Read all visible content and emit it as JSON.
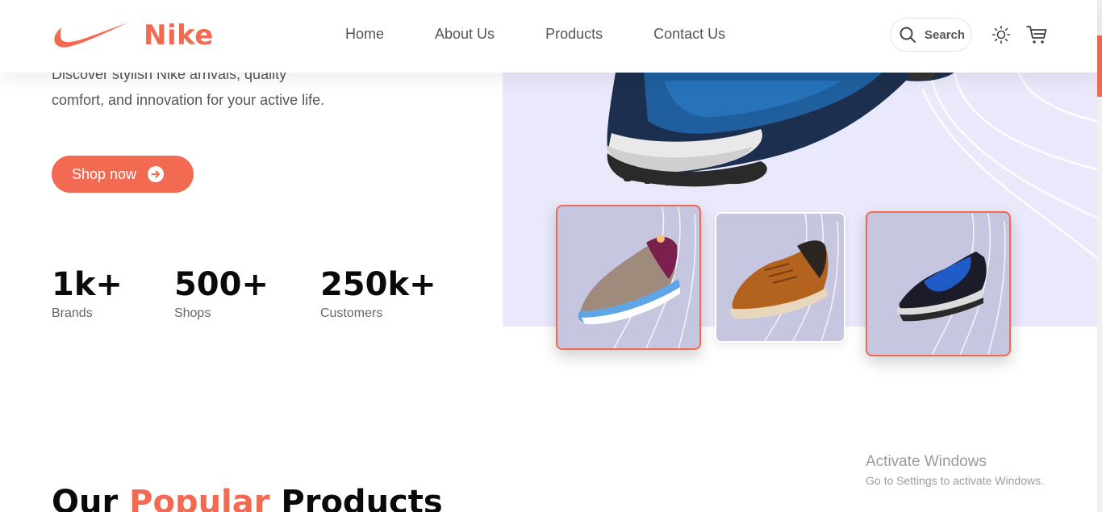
{
  "brand": {
    "name": "Nike",
    "accent_color": "#f26a52"
  },
  "nav": {
    "items": [
      {
        "label": "Home"
      },
      {
        "label": "About Us"
      },
      {
        "label": "Products"
      },
      {
        "label": "Contact Us"
      }
    ]
  },
  "header": {
    "search_label": "Search",
    "theme_icon": "sun-icon",
    "cart_icon": "cart-icon",
    "search_icon": "search-icon"
  },
  "hero": {
    "description_partial": "Discover stylish Nike arrivals, quality",
    "description_line2": "comfort, and innovation for your active life.",
    "cta_label": "Shop now",
    "cta_icon": "arrow-right-circle-icon",
    "stats": [
      {
        "value": "1k+",
        "label": "Brands"
      },
      {
        "value": "500+",
        "label": "Shops"
      },
      {
        "value": "250k+",
        "label": "Customers"
      }
    ],
    "panel_color": "#e9e9fb",
    "thumbnails": [
      {
        "name": "beige-purple-sneaker",
        "selected": true
      },
      {
        "name": "brown-leather-sneaker",
        "selected": false
      },
      {
        "name": "blue-black-trail-shoe",
        "selected": true
      }
    ]
  },
  "popular": {
    "title_part1": "Our ",
    "title_accent": "Popular",
    "title_part2": " Products"
  },
  "watermark": {
    "title": "Activate Windows",
    "subtitle": "Go to Settings to activate Windows."
  }
}
